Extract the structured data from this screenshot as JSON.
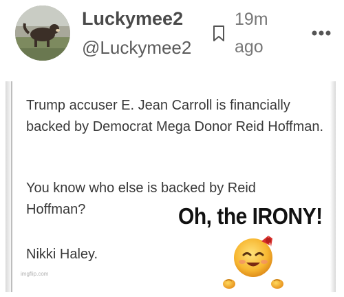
{
  "post": {
    "display_name": "Luckymee2",
    "handle": "@Luckymee2",
    "timestamp": "19m ago",
    "icons": {
      "avatar": "dog-in-field-avatar",
      "bookmark": "bookmark-icon",
      "more": "more-horizontal-icon"
    }
  },
  "image": {
    "paragraph_1": "Trump accuser E. Jean Carroll is financially backed by Democrat Mega Donor Reid Hoffman.",
    "paragraph_2": "You know who else is backed by Reid Hoffman?",
    "paragraph_3": "Nikki Haley.",
    "caption": "Oh, the IRONY!",
    "watermark": "imgflip.com",
    "emoji": "laughing-face-with-bow-emoji"
  },
  "colors": {
    "background": "#ffffff",
    "name_text": "#4a4a4a",
    "meta_text": "#777777",
    "body_text": "#383838",
    "emoji_yellow": "#f7b731",
    "bow_red": "#d9302c"
  }
}
